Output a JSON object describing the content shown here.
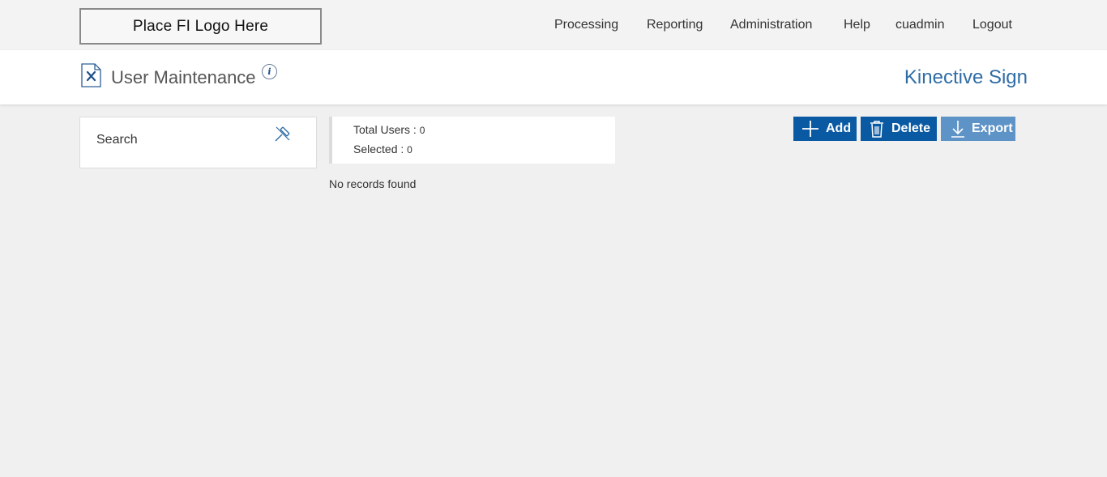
{
  "logo": {
    "text": "Place FI Logo Here"
  },
  "nav": {
    "processing": "Processing",
    "reporting": "Reporting",
    "administration": "Administration",
    "help": "Help",
    "user": "cuadmin",
    "logout": "Logout"
  },
  "header": {
    "title": "User Maintenance",
    "product": "Kinective Sign",
    "info_icon": "info-icon",
    "page_icon": "document-tools-icon"
  },
  "search": {
    "label": "Search",
    "icon": "pin-icon"
  },
  "summary": {
    "total_label": "Total Users : ",
    "total_value": "0",
    "selected_label": "Selected : ",
    "selected_value": "0"
  },
  "status": {
    "empty_text": "No records found"
  },
  "actions": {
    "add_label": "Add",
    "delete_label": "Delete",
    "export_label": "Export"
  },
  "colors": {
    "primary": "#0a5aa3",
    "disabled_button": "#5d93c7",
    "product_text": "#2f6da6",
    "background": "#f0f0f0"
  }
}
